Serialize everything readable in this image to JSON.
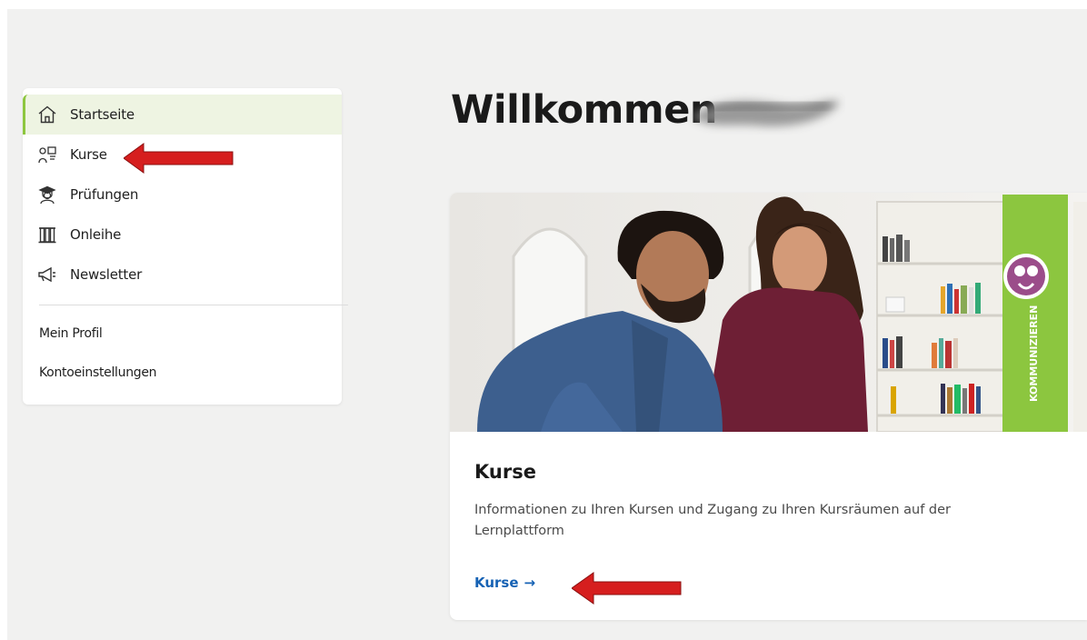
{
  "sidebar": {
    "items": [
      {
        "label": "Startseite",
        "icon": "home-icon",
        "active": true
      },
      {
        "label": "Kurse",
        "icon": "course-icon"
      },
      {
        "label": "Prüfungen",
        "icon": "graduate-icon"
      },
      {
        "label": "Onleihe",
        "icon": "library-icon"
      },
      {
        "label": "Newsletter",
        "icon": "megaphone-icon"
      }
    ],
    "links": [
      "Mein Profil",
      "Kontoeinstellungen"
    ]
  },
  "main": {
    "heading": "Willkommen",
    "card": {
      "image_sign_text": "KOMMUNIZIEREN",
      "title": "Kurse",
      "description": "Informationen zu Ihren Kursen und Zugang zu Ihren Kursräumen auf der Lernplattform",
      "link_label": "Kurse",
      "link_arrow": "→"
    }
  },
  "colors": {
    "accent_green": "#8dc63f",
    "active_bg": "#eef4e2",
    "link_blue": "#1662b4",
    "annotation_red": "#d61e1e",
    "page_bg": "#f1f1f0"
  }
}
